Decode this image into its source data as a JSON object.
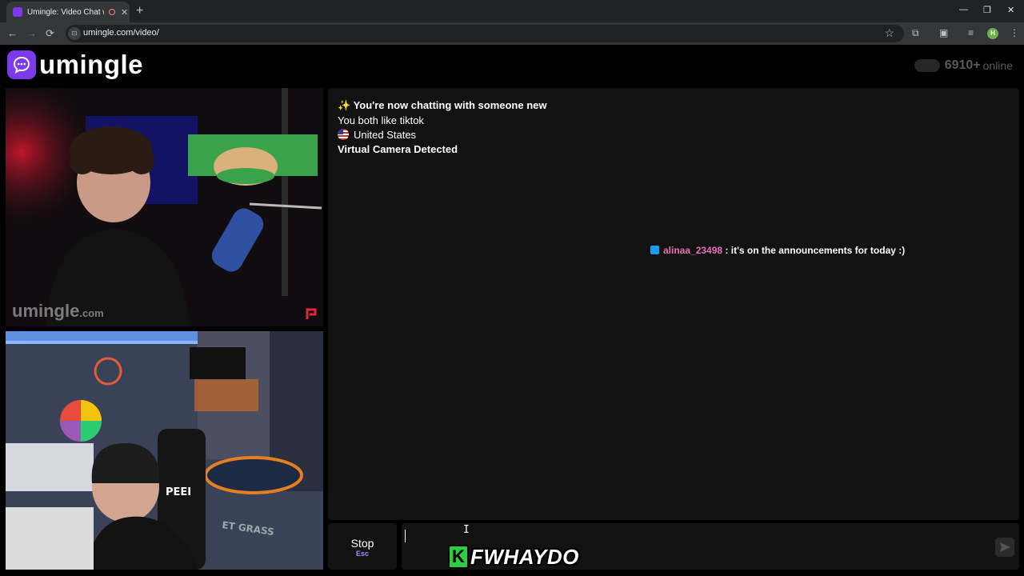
{
  "browser": {
    "tab_title": "Umingle: Video Chat with S",
    "tab_close": "✕",
    "new_tab": "+",
    "url": "umingle.com/video/",
    "controls": {
      "minimize": "—",
      "restore": "❐",
      "close": "✕"
    },
    "nav": {
      "back": "←",
      "forward": "→",
      "reload": "⟳"
    },
    "site_icon": "⊡",
    "bookmark": "☆",
    "profile_initial": "H"
  },
  "header": {
    "logo_text": "umingle",
    "online_count": "6910+",
    "online_label": "online"
  },
  "video": {
    "watermark_main": "umingle",
    "watermark_suffix": ".com",
    "chair_text": "PEEI",
    "mat_text": "ET GRASS"
  },
  "chat": {
    "system_new": "✨ You're now chatting with someone new",
    "common_interest": "You both like tiktok",
    "country": "United States",
    "camera_notice": "Virtual Camera Detected",
    "message": {
      "user": "alinaa_23498",
      "separator": " : ",
      "text": "it's on the announcements for today :)"
    }
  },
  "controls": {
    "stop_label": "Stop",
    "stop_hint": "Esc",
    "input_value": "",
    "cursor_glyph": "I"
  },
  "overlay": {
    "badge": "K",
    "text": "FWHAYDO"
  },
  "colors": {
    "brand": "#7c3aed",
    "username": "#e86fb6",
    "panel": "#121212"
  }
}
